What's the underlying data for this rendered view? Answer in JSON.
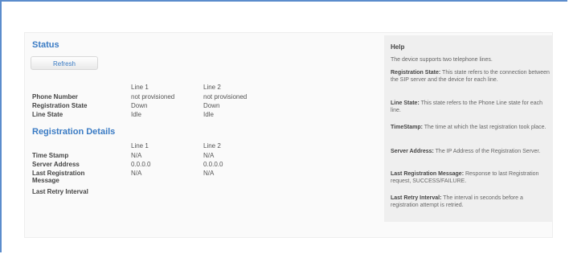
{
  "status": {
    "title": "Status",
    "refresh_label": "Refresh",
    "col_line1": "Line 1",
    "col_line2": "Line 2",
    "rows": [
      {
        "label": "Phone Number",
        "line1": "not provisioned",
        "line2": "not provisioned"
      },
      {
        "label": "Registration State",
        "line1": "Down",
        "line2": "Down"
      },
      {
        "label": "Line State",
        "line1": "Idle",
        "line2": "Idle"
      }
    ]
  },
  "registration": {
    "title": "Registration Details",
    "col_line1": "Line 1",
    "col_line2": "Line 2",
    "rows": [
      {
        "label": "Time Stamp",
        "line1": "N/A",
        "line2": "N/A"
      },
      {
        "label": "Server Address",
        "line1": "0.0.0.0",
        "line2": "0.0.0.0"
      },
      {
        "label": "Last Registration",
        "label2": "Message",
        "line1": "N/A",
        "line2": "N/A"
      },
      {
        "label": "Last Retry Interval",
        "line1": "",
        "line2": ""
      }
    ]
  },
  "help": {
    "title": "Help",
    "intro": "The device supports two telephone lines.",
    "items": [
      {
        "term": "Registration State:",
        "text": " This state refers to the connection between the SIP server and the device for each line."
      },
      {
        "term": "Line State:",
        "text": " This state refers to the Phone Line state for each line."
      },
      {
        "term": "TimeStamp:",
        "text": " The time at which the last registration took place."
      },
      {
        "term": "Server Address:",
        "text": " The IP Address of the Registration Server."
      },
      {
        "term": "Last Registration Message:",
        "text": " Response to last Registration request, SUCCESS/FAILURE."
      },
      {
        "term": "Last Retry Interval:",
        "text": " The interval in seconds before a registration attempt is retried."
      }
    ]
  }
}
